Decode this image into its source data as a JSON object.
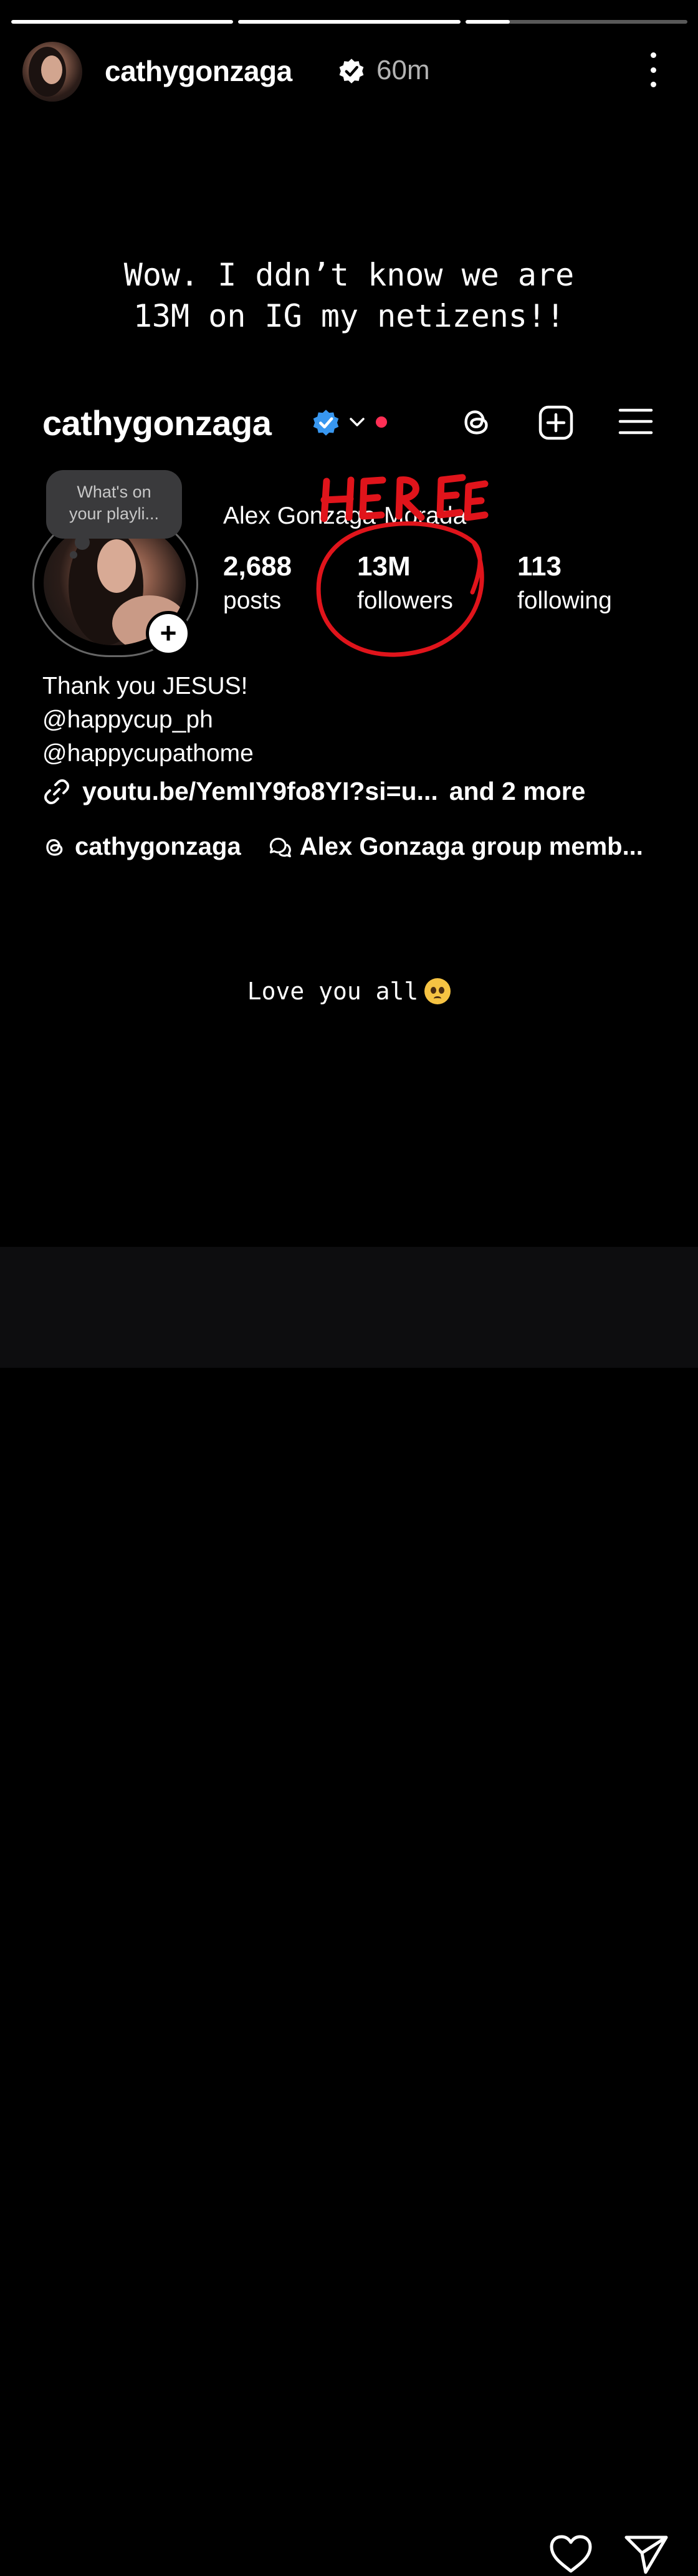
{
  "story": {
    "progress": [
      1.0,
      1.0,
      0.2
    ],
    "username": "cathygonzaga",
    "time_ago": "60m",
    "caption_line1": "Wow. I ddn’t know we are",
    "caption_line2": "13M on IG my netizens!!",
    "love_text": "Love you all",
    "annotation_text": "HERE"
  },
  "profile": {
    "username": "cathygonzaga",
    "note_line1": "What's on",
    "note_line2": "your playli...",
    "full_name": "Alex Gonzaga-Morada",
    "posts_count": "2,688",
    "posts_label": "posts",
    "followers_count": "13M",
    "followers_label": "followers",
    "following_count": "113",
    "following_label": "following",
    "bio_line1": "Thank you JESUS!",
    "bio_line2": "@happycup_ph",
    "bio_line3": "@happycupathome",
    "link_text": "youtu.be/YemIY9fo8YI?si=u...",
    "link_more": "and 2 more",
    "threads_handle": "cathygonzaga",
    "group_label": "Alex Gonzaga group memb..."
  },
  "icons": {
    "verified_color": "#3897f0",
    "annotation_color": "#e0141b"
  }
}
